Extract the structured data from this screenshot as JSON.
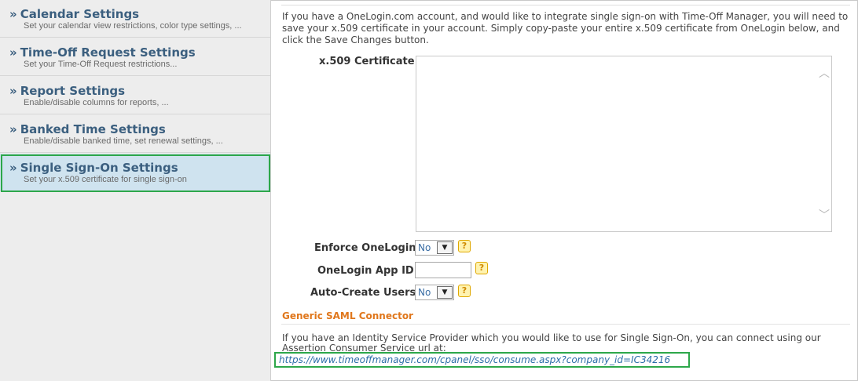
{
  "sidebar": {
    "items": [
      {
        "title": "Calendar Settings",
        "subtitle": "Set your calendar view restrictions, color type settings, ...",
        "active": false
      },
      {
        "title": "Time-Off Request Settings",
        "subtitle": "Set your Time-Off Request restrictions...",
        "active": false
      },
      {
        "title": "Report Settings",
        "subtitle": "Enable/disable columns for reports, ...",
        "active": false
      },
      {
        "title": "Banked Time Settings",
        "subtitle": "Enable/disable banked time, set renewal settings, ...",
        "active": false
      },
      {
        "title": "Single Sign-On Settings",
        "subtitle": "Set your x.509 certificate for single sign-on",
        "active": true
      }
    ],
    "bullet": "»"
  },
  "main": {
    "intro_text": "If you have a OneLogin.com account, and would like to integrate single sign-on with Time-Off Manager, you will need to save your x.509 certificate in your account. Simply copy-paste your entire x.509 certificate from OneLogin below, and click the Save Changes button.",
    "certificate": {
      "label": "x.509 Certificate:",
      "value": ""
    },
    "enforce_onelogin": {
      "label": "Enforce OneLogin:",
      "value": "No",
      "help": "?"
    },
    "onelogin_app_id": {
      "label": "OneLogin App ID:",
      "value": "",
      "help": "?"
    },
    "auto_create_users": {
      "label": "Auto-Create Users:",
      "value": "No",
      "help": "?"
    },
    "saml": {
      "section_title": "Generic SAML Connector",
      "description": "If you have an Identity Service Provider which you would like to use for Single Sign-On, you can connect using our Assertion Consumer Service url at:",
      "acs_url": "https://www.timeoffmanager.com/cpanel/sso/consume.aspx?company_id=IC34216"
    }
  },
  "colors": {
    "sidebar_title": "#3b5f7f",
    "section_title": "#e0771c",
    "highlight_border": "#2da74a",
    "link": "#2b6da8",
    "active_item_bg": "#cfe3ef"
  }
}
